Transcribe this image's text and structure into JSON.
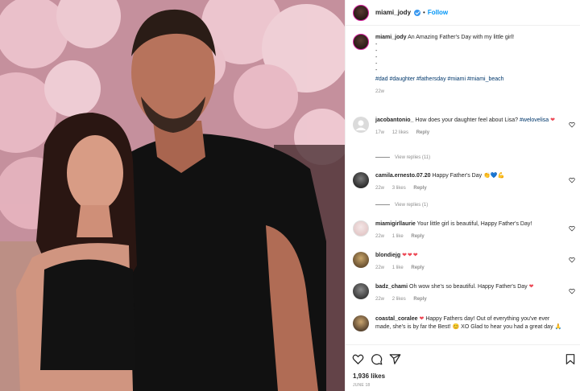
{
  "post": {
    "username": "miami_jody",
    "dot": "•",
    "follow_label": "Follow",
    "caption_user": "miami_jody",
    "caption_text": "An Amazing Father's Day with my little girl!",
    "caption_dashes": [
      "-",
      "-",
      "-",
      "-",
      "-"
    ],
    "hashtags": "#dad #daughter #fathersday #miami #miami_beach",
    "caption_time": "22w",
    "likes": "1,936 likes",
    "date": "JUNE 18"
  },
  "comments": [
    {
      "user": "jacobantonio_",
      "text": "How does your daughter feel about Lisa?",
      "tag": "#welovelisa",
      "emoji": "heart",
      "time": "17w",
      "likes": "12 likes",
      "reply": "Reply",
      "view_replies": "View replies (11)"
    },
    {
      "user": "camila.ernesto.07.20",
      "text": "Happy Father's Day",
      "emoji": "clap-heart-muscle",
      "time": "22w",
      "likes": "3 likes",
      "reply": "Reply",
      "view_replies": "View replies (1)"
    },
    {
      "user": "miamigirllaurie",
      "text": "Your little girl is beautiful, Happy Father's Day!",
      "time": "22w",
      "likes": "1 like",
      "reply": "Reply"
    },
    {
      "user": "blondiejg",
      "text": "",
      "emoji": "three-hearts",
      "time": "22w",
      "likes": "1 like",
      "reply": "Reply"
    },
    {
      "user": "badz_chami",
      "text": "Oh wow she's so beautiful. Happy Father's Day",
      "emoji": "heart",
      "time": "22w",
      "likes": "2 likes",
      "reply": "Reply"
    },
    {
      "user": "coastal_coralee",
      "text_a": "Happy Fathers day! Out of everything you've ever made, she's is by far the Best!",
      "text_b": "XO Glad to hear you had a great day",
      "emoji": "heart-smile-pray"
    }
  ],
  "colors": {
    "accent": "#0095f6",
    "heart": "#ed4956",
    "muted": "#8e8e8e",
    "hashtag": "#00376b"
  },
  "icons": [
    "verified-icon",
    "heart-icon",
    "comment-icon",
    "share-icon",
    "save-icon"
  ]
}
